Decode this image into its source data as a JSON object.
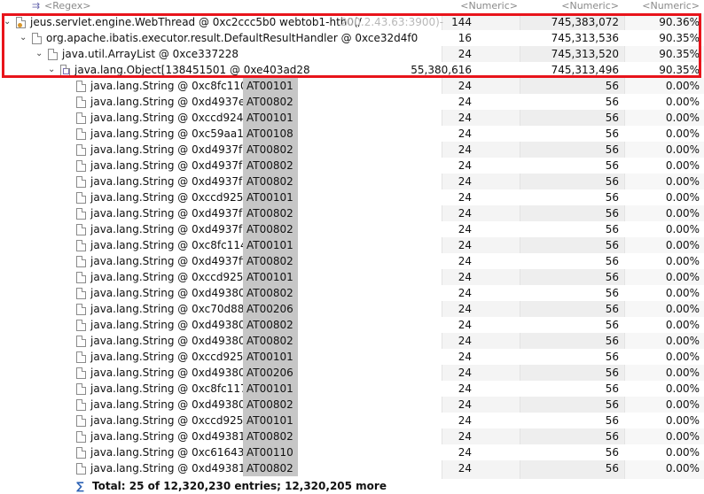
{
  "header": {
    "regex_placeholder": "<Regex>",
    "col1": "<Numeric>",
    "col2": "<Numeric>",
    "col3": "<Numeric>"
  },
  "tree": [
    {
      "name": "jeus.servlet.engine.WebThread @ 0xc2ccc5b0  webtob1-hth0(/",
      "name_obscured": "200.2.43.63:3900)-",
      "shallow": "144",
      "retained": "745,383,072",
      "percent": "90.36%"
    },
    {
      "name": "org.apache.ibatis.executor.result.DefaultResultHandler @ 0xce32d4f0",
      "shallow": "16",
      "retained": "745,313,536",
      "percent": "90.35%"
    },
    {
      "name": "java.util.ArrayList @ 0xce337228",
      "shallow": "24",
      "retained": "745,313,520",
      "percent": "90.35%"
    },
    {
      "name": "java.lang.Object[138451501 @ 0xe403ad28",
      "shallow": "55,380,616",
      "retained": "745,313,496",
      "percent": "90.35%"
    }
  ],
  "strings": [
    {
      "name": "java.lang.String @ 0xc8fc1108",
      "value": "AT00101",
      "shallow": "24",
      "retained": "56",
      "percent": "0.00%"
    },
    {
      "name": "java.lang.String @ 0xd4937ee0",
      "value": "AT00802",
      "shallow": "24",
      "retained": "56",
      "percent": "0.00%"
    },
    {
      "name": "java.lang.String @ 0xccd924f0",
      "value": "AT00101",
      "shallow": "24",
      "retained": "56",
      "percent": "0.00%"
    },
    {
      "name": "java.lang.String @ 0xc59aa100",
      "value": "AT00108",
      "shallow": "24",
      "retained": "56",
      "percent": "0.00%"
    },
    {
      "name": "java.lang.String @ 0xd4937f38",
      "value": "AT00802",
      "shallow": "24",
      "retained": "56",
      "percent": "0.00%"
    },
    {
      "name": "java.lang.String @ 0xd4937f50",
      "value": "AT00802",
      "shallow": "24",
      "retained": "56",
      "percent": "0.00%"
    },
    {
      "name": "java.lang.String @ 0xd4937f68",
      "value": "AT00802",
      "shallow": "24",
      "retained": "56",
      "percent": "0.00%"
    },
    {
      "name": "java.lang.String @ 0xccd92528",
      "value": "AT00101",
      "shallow": "24",
      "retained": "56",
      "percent": "0.00%"
    },
    {
      "name": "java.lang.String @ 0xd4937fa0",
      "value": "AT00802",
      "shallow": "24",
      "retained": "56",
      "percent": "0.00%"
    },
    {
      "name": "java.lang.String @ 0xd4937fb8",
      "value": "AT00802",
      "shallow": "24",
      "retained": "56",
      "percent": "0.00%"
    },
    {
      "name": "java.lang.String @ 0xc8fc1140",
      "value": "AT00101",
      "shallow": "24",
      "retained": "56",
      "percent": "0.00%"
    },
    {
      "name": "java.lang.String @ 0xd4937ff0",
      "value": "AT00802",
      "shallow": "24",
      "retained": "56",
      "percent": "0.00%"
    },
    {
      "name": "java.lang.String @ 0xccd92560",
      "value": "AT00101",
      "shallow": "24",
      "retained": "56",
      "percent": "0.00%"
    },
    {
      "name": "java.lang.String @ 0xd4938028",
      "value": "AT00802",
      "shallow": "24",
      "retained": "56",
      "percent": "0.00%"
    },
    {
      "name": "java.lang.String @ 0xc70d8888",
      "value": "AT00206",
      "shallow": "24",
      "retained": "56",
      "percent": "0.00%"
    },
    {
      "name": "java.lang.String @ 0xd4938060",
      "value": "AT00802",
      "shallow": "24",
      "retained": "56",
      "percent": "0.00%"
    },
    {
      "name": "java.lang.String @ 0xd4938078",
      "value": "AT00802",
      "shallow": "24",
      "retained": "56",
      "percent": "0.00%"
    },
    {
      "name": "java.lang.String @ 0xccd92598",
      "value": "AT00101",
      "shallow": "24",
      "retained": "56",
      "percent": "0.00%"
    },
    {
      "name": "java.lang.String @ 0xd49380b0",
      "value": "AT00206",
      "shallow": "24",
      "retained": "56",
      "percent": "0.00%"
    },
    {
      "name": "java.lang.String @ 0xc8fc1178",
      "value": "AT00101",
      "shallow": "24",
      "retained": "56",
      "percent": "0.00%"
    },
    {
      "name": "java.lang.String @ 0xd49380e8",
      "value": "AT00802",
      "shallow": "24",
      "retained": "56",
      "percent": "0.00%"
    },
    {
      "name": "java.lang.String @ 0xccd925d0",
      "value": "AT00101",
      "shallow": "24",
      "retained": "56",
      "percent": "0.00%"
    },
    {
      "name": "java.lang.String @ 0xd4938120",
      "value": "AT00802",
      "shallow": "24",
      "retained": "56",
      "percent": "0.00%"
    },
    {
      "name": "java.lang.String @ 0xc61643e8",
      "value": "AT00110",
      "shallow": "24",
      "retained": "56",
      "percent": "0.00%"
    },
    {
      "name": "java.lang.String @ 0xd4938158",
      "value": "AT00802",
      "shallow": "24",
      "retained": "56",
      "percent": "0.00%"
    }
  ],
  "total": {
    "label": "Total: 25 of 12,320,230 entries; 12,320,205 more"
  },
  "icons": {
    "regex_row": "regex-filter-icon",
    "thread": "thread-object-icon",
    "object": "object-file-icon",
    "array": "array-object-icon",
    "total": "sigma-icon"
  },
  "colors": {
    "highlight_border": "#e8141b",
    "value_bg": "#c6c6c6"
  }
}
